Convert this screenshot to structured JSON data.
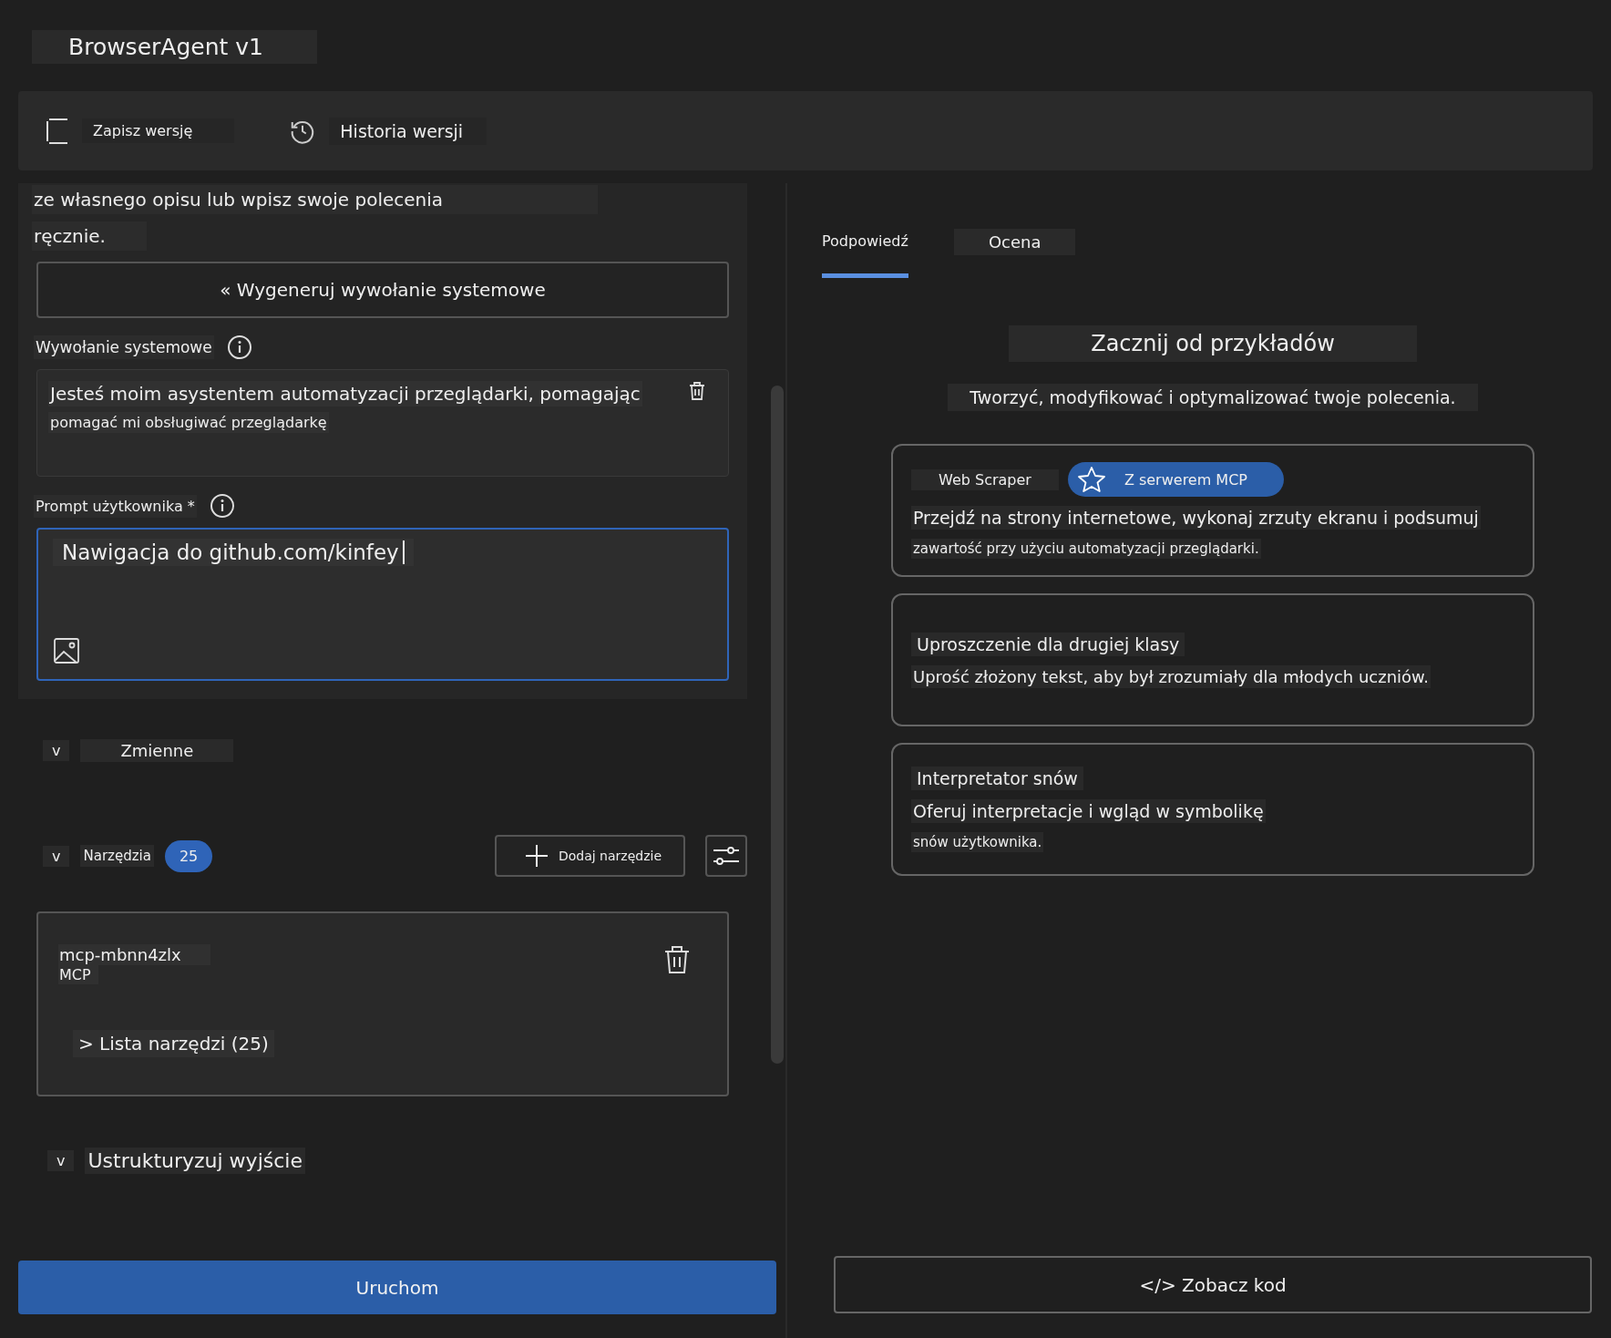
{
  "title": "BrowserAgent v1",
  "toolbar": [
    {
      "kind": "save",
      "label": "Zapisz wersję"
    },
    {
      "kind": "history",
      "label": "Historia wersji"
    }
  ],
  "intro": [
    "ze własnego opisu lub wpisz swoje polecenia",
    "ręcznie."
  ],
  "generate_button": "« Wygeneruj wywołanie systemowe",
  "system_prompt": {
    "label": "Wywołanie systemowe",
    "lines": [
      "Jesteś moim asystentem automatyzacji przeglądarki, pomagając",
      "pomagać mi obsługiwać przeglądarkę"
    ]
  },
  "user_prompt": {
    "label": "Prompt użytkownika *",
    "value": "Nawigacja do github.com/kinfey",
    "focused": true
  },
  "variables": {
    "toggle": "v",
    "label": "Zmienne"
  },
  "tools_section": {
    "toggle": "v",
    "label": "Narzędzia",
    "count": "25",
    "add_button": "Dodaj narzędzie"
  },
  "tools": [
    {
      "name": "mcp-mbnn4zlx",
      "type": "MCP",
      "list_label": "> Lista narzędzi (25)"
    }
  ],
  "structured_output": {
    "toggle": "v",
    "label": "Ustrukturyzuj wyjście"
  },
  "run_button": "Uruchom",
  "tabs": [
    {
      "label": "Podpowiedź",
      "selected": true
    },
    {
      "label": "Ocena",
      "selected": false
    }
  ],
  "examples": {
    "heading": "Zacznij od przykładów",
    "subtitle": "Tworzyć, modyfikować i optymalizować twoje polecenia.",
    "cards": [
      {
        "title": "Web Scraper",
        "tag": "Z serwerem MCP",
        "lines": [
          "Przejdź na strony internetowe, wykonaj zrzuty ekranu i podsumuj",
          "zawartość przy użyciu automatyzacji przeglądarki."
        ]
      },
      {
        "title": "Uproszczenie dla drugiej klasy",
        "lines": [
          "Uprość złożony tekst, aby był zrozumiały dla młodych uczniów."
        ]
      },
      {
        "title": "Interpretator snów",
        "lines": [
          "Oferuj interpretacje i wgląd w symbolikę",
          "snów użytkownika."
        ]
      }
    ]
  },
  "code_button": "</> Zobacz kod"
}
